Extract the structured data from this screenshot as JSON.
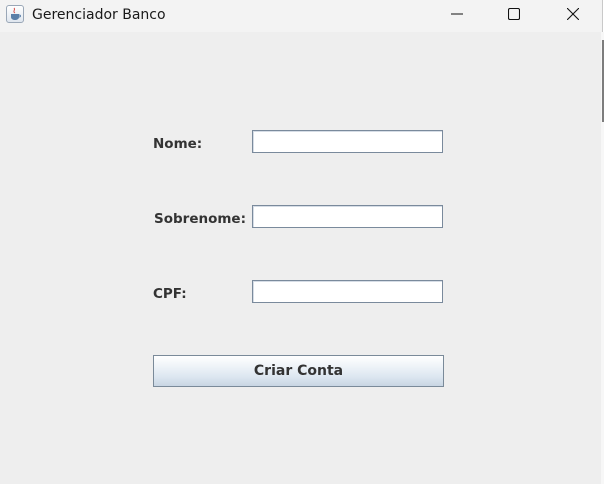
{
  "window": {
    "title": "Gerenciador Banco",
    "icon": "java-cup-icon",
    "controls": {
      "minimize": "minimize-icon",
      "maximize": "maximize-icon",
      "close": "close-icon"
    }
  },
  "form": {
    "nome_label": "Nome:",
    "nome_value": "",
    "sobrenome_label": "Sobrenome:",
    "sobrenome_value": "",
    "cpf_label": "CPF:",
    "cpf_value": "",
    "submit_label": "Criar Conta"
  },
  "colors": {
    "window_bg": "#eeeeee",
    "label_text": "#333333",
    "field_border": "#7a8a9c"
  }
}
